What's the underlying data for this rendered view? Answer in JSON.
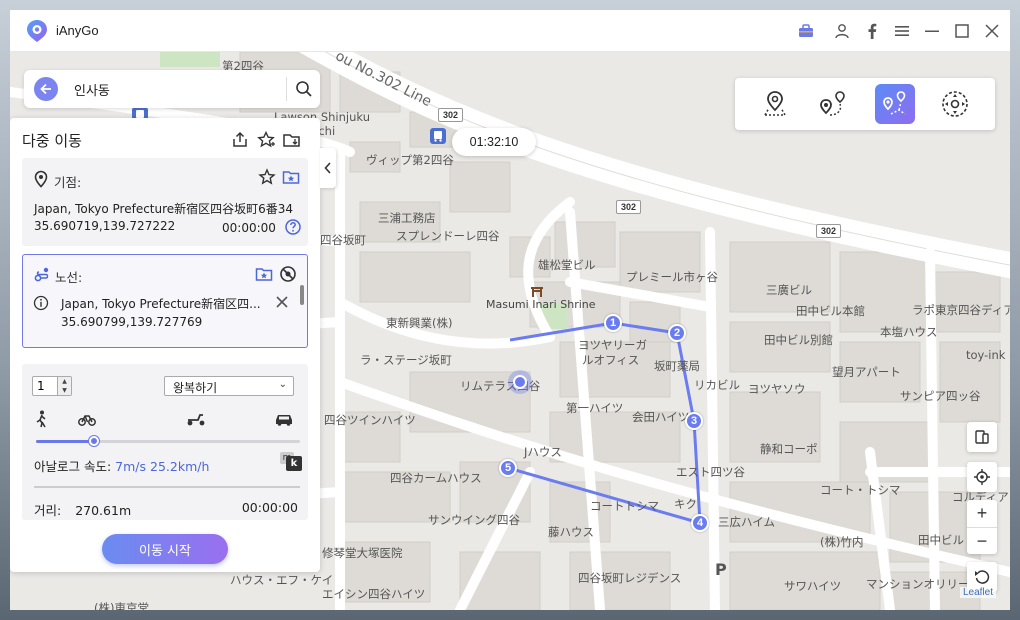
{
  "app": {
    "name": "iAnyGo"
  },
  "search": {
    "value": "인사동"
  },
  "panel": {
    "title": "다중 이동",
    "start": {
      "label": "기점:",
      "address": "Japan, Tokyo Prefecture新宿区四谷坂町6番34",
      "coords": "35.690719,139.727222",
      "time": "00:00:00"
    },
    "route": {
      "label": "노선:",
      "index": "1",
      "address": "Japan, Tokyo Prefecture新宿区四...",
      "coords": "35.690799,139.727769"
    },
    "repeat_count": "1",
    "mode_select": "왕복하기",
    "speed_label": "아날로그 속도:",
    "speed_value": "7m/s 25.2km/h",
    "speed_fraction": 0.22,
    "unit_m": "m",
    "unit_k": "k",
    "distance_label": "거리:",
    "distance_value": "270.61m",
    "total_time": "00:00:00",
    "start_button": "이동 시작"
  },
  "timer": "01:32:10",
  "waypoints": [
    "1",
    "2",
    "3",
    "4",
    "5"
  ],
  "map": {
    "road_name": "ou No.302 Line",
    "shields": [
      "302",
      "302",
      "302"
    ],
    "attribution": "Leaflet",
    "parking": "P",
    "labels": [
      "第2四谷",
      "Lawson Shinjuku",
      "nachi",
      "ヴィップ第2四谷",
      "三浦工務店",
      "スプレンドーレ四谷",
      "四谷坂町",
      "雄松堂ビル",
      "プレミール市ヶ谷",
      "三廣ビル",
      "田中ビル本館",
      "ラポ東京四谷ディア",
      "Masumi Inari Shrine",
      "東新興業(株)",
      "ヨツヤリーガ",
      "ルオフィス",
      "坂町薬局",
      "田中ビル別館",
      "本塩ハウス",
      "toy-ink",
      "ラ・ステージ坂町",
      "リカビル",
      "ヨツヤソウ",
      "望月アパート",
      "リムテラス四谷",
      "サンピア四ッ谷",
      "第一ハイツ",
      "会田ハイツ",
      "四谷ツインハイツ",
      "静和コーポ",
      "Jハウス",
      "エスト四ツ谷",
      "四谷カームハウス",
      "コート・トシマ",
      "コルディア",
      "コートトシマ",
      "キク",
      "サンウイング四谷",
      "三広ハイム",
      "藤ハウス",
      "(株)竹内",
      "田中ビル",
      "修琴堂大塚医院",
      "四谷坂町レジデンス",
      "ハウス・エフ・ケイ",
      "サワハイツ",
      "マンションオリリー",
      "エイシン四谷ハイツ",
      "(株)東京堂"
    ]
  },
  "colors": {
    "accent": "#6b7cf0",
    "route": "#6b7cf0"
  }
}
